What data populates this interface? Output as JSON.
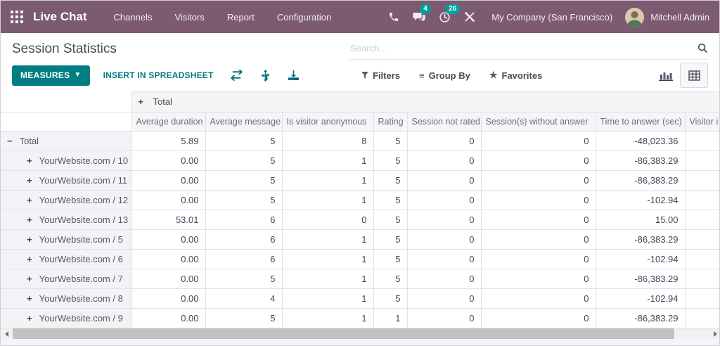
{
  "colors": {
    "navbar": "#7c5a72",
    "teal": "#017e84",
    "badge": "#00a09d"
  },
  "nav": {
    "app_name": "Live Chat",
    "menus": [
      "Channels",
      "Visitors",
      "Report",
      "Configuration"
    ],
    "message_badge": "4",
    "activity_badge": "26",
    "company": "My Company (San Francisco)",
    "user": "Mitchell Admin"
  },
  "control": {
    "title": "Session Statistics",
    "search_placeholder": "Search...",
    "measures_label": "MEASURES",
    "insert_label": "INSERT IN SPREADSHEET",
    "filters_label": "Filters",
    "group_by_label": "Group By",
    "favorites_label": "Favorites"
  },
  "pivot": {
    "col_group_label": "Total",
    "measure_headers": [
      "Average duration",
      "Average message",
      "Is visitor anonymous",
      "Rating",
      "Session not rated",
      "Session(s) without answer",
      "Time to answer (sec)",
      "Visitor i"
    ],
    "rows": [
      {
        "label": "Total",
        "expanded": true,
        "level": 0,
        "values": [
          "5.89",
          "5",
          "8",
          "5",
          "0",
          "0",
          "-48,023.36",
          ""
        ]
      },
      {
        "label": "YourWebsite.com / 10",
        "expanded": false,
        "level": 1,
        "values": [
          "0.00",
          "5",
          "1",
          "5",
          "0",
          "0",
          "-86,383.29",
          ""
        ]
      },
      {
        "label": "YourWebsite.com / 11",
        "expanded": false,
        "level": 1,
        "values": [
          "0.00",
          "5",
          "1",
          "5",
          "0",
          "0",
          "-86,383.29",
          ""
        ]
      },
      {
        "label": "YourWebsite.com / 12",
        "expanded": false,
        "level": 1,
        "values": [
          "0.00",
          "5",
          "1",
          "5",
          "0",
          "0",
          "-102.94",
          ""
        ]
      },
      {
        "label": "YourWebsite.com / 13",
        "expanded": false,
        "level": 1,
        "values": [
          "53.01",
          "6",
          "0",
          "5",
          "0",
          "0",
          "15.00",
          ""
        ]
      },
      {
        "label": "YourWebsite.com / 5",
        "expanded": false,
        "level": 1,
        "values": [
          "0.00",
          "6",
          "1",
          "5",
          "0",
          "0",
          "-86,383.29",
          ""
        ]
      },
      {
        "label": "YourWebsite.com / 6",
        "expanded": false,
        "level": 1,
        "values": [
          "0.00",
          "6",
          "1",
          "5",
          "0",
          "0",
          "-102.94",
          ""
        ]
      },
      {
        "label": "YourWebsite.com / 7",
        "expanded": false,
        "level": 1,
        "values": [
          "0.00",
          "5",
          "1",
          "5",
          "0",
          "0",
          "-86,383.29",
          ""
        ]
      },
      {
        "label": "YourWebsite.com / 8",
        "expanded": false,
        "level": 1,
        "values": [
          "0.00",
          "4",
          "1",
          "5",
          "0",
          "0",
          "-102.94",
          ""
        ]
      },
      {
        "label": "YourWebsite.com / 9",
        "expanded": false,
        "level": 1,
        "values": [
          "0.00",
          "5",
          "1",
          "1",
          "0",
          "0",
          "-86,383.29",
          ""
        ]
      }
    ]
  }
}
